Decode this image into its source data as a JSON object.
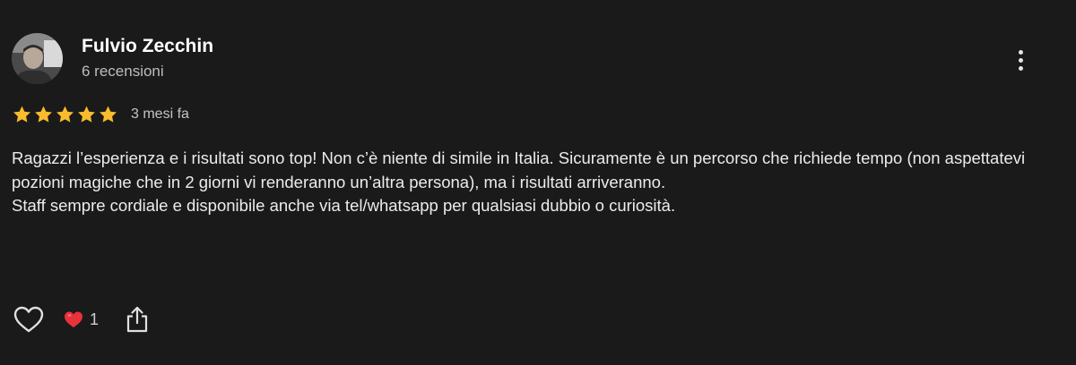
{
  "review": {
    "author": {
      "name": "Fulvio Zecchin",
      "reviews_count": "6 recensioni"
    },
    "rating": 5,
    "date": "3 mesi fa",
    "paragraphs": [
      "Ragazzi l’esperienza e i risultati sono top! Non c’è niente di simile in Italia. Sicuramente è un percorso che richiede tempo (non aspettatevi pozioni magiche che in 2 giorni vi renderanno un’altra persona), ma i risultati arriveranno.",
      "Staff sempre cordiale e disponibile anche via tel/whatsapp per qualsiasi dubbio o curiosità."
    ],
    "reactions": {
      "heart_count": "1"
    }
  },
  "colors": {
    "background": "#1a1a1a",
    "star": "#f9bc2c",
    "heart": "#e8323c",
    "text": "#ececec",
    "muted": "#bdbdbd"
  },
  "icons": {
    "like": "heart-outline-icon",
    "reaction": "red-heart-icon",
    "share": "share-icon",
    "more": "more-vertical-icon"
  }
}
